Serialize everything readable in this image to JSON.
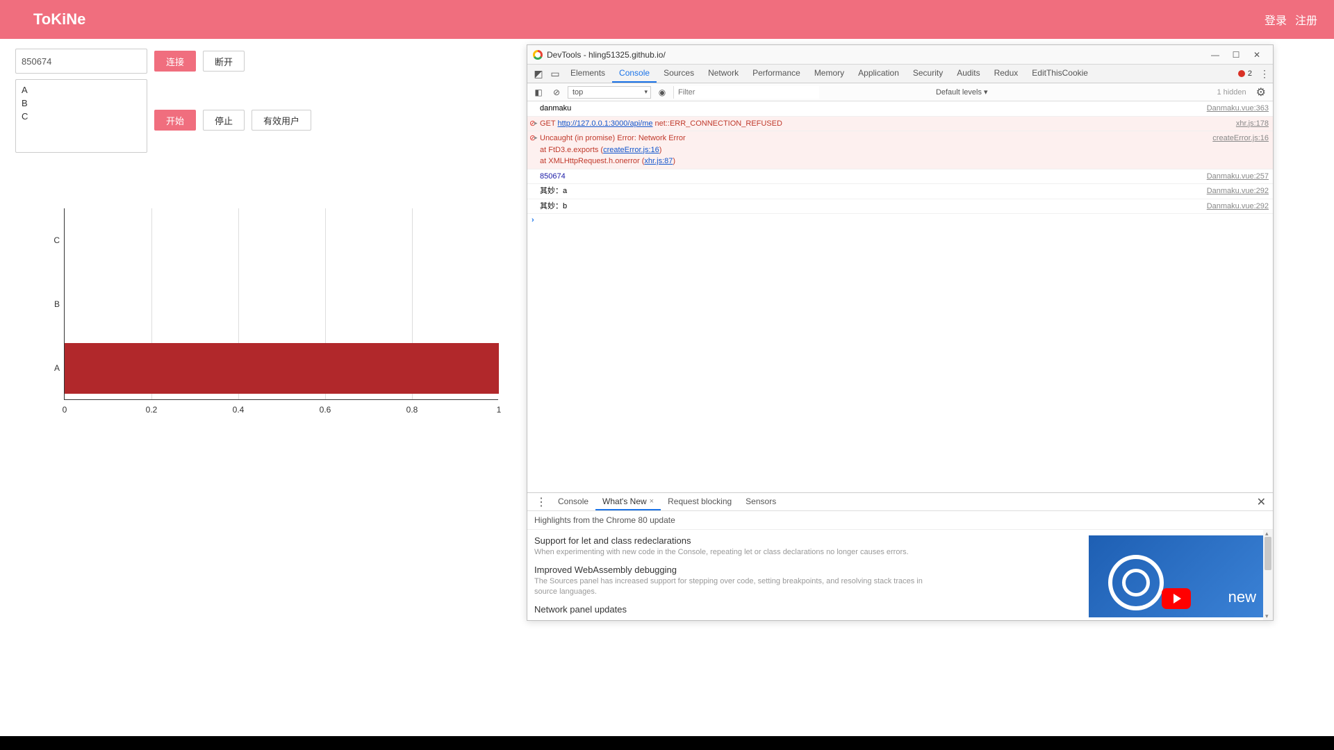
{
  "topbar": {
    "brand": "ToKiNe",
    "login": "登录",
    "register": "注册"
  },
  "controls": {
    "input_value": "850674",
    "connect": "连接",
    "disconnect": "断开",
    "log_text": "A\nB\nC",
    "start": "开始",
    "stop": "停止",
    "valid_users": "有效用户"
  },
  "chart_data": {
    "type": "bar",
    "orientation": "horizontal",
    "categories": [
      "A",
      "B",
      "C"
    ],
    "values": [
      1.0,
      0,
      0
    ],
    "xlabel": "",
    "ylabel": "",
    "xlim": [
      0,
      1
    ],
    "xticks": [
      0,
      0.2,
      0.4,
      0.6,
      0.8,
      1
    ],
    "bar_color": "#b1282b"
  },
  "devtools": {
    "title": "DevTools - hling51325.github.io/",
    "tabs": [
      "Elements",
      "Console",
      "Sources",
      "Network",
      "Performance",
      "Memory",
      "Application",
      "Security",
      "Audits",
      "Redux",
      "EditThisCookie"
    ],
    "active_tab": "Console",
    "error_count": "2",
    "toolbar": {
      "context": "top",
      "filter_placeholder": "Filter",
      "levels": "Default levels ▾",
      "hidden": "1 hidden"
    },
    "logs": [
      {
        "type": "log",
        "msg": "danmaku",
        "src": "Danmaku.vue:363"
      },
      {
        "type": "error",
        "expandable": true,
        "pre": "GET ",
        "link": "http://127.0.0.1:3000/api/me",
        "post": " net::ERR_CONNECTION_REFUSED",
        "src": "xhr.js:178"
      },
      {
        "type": "error",
        "expandable": true,
        "msg": "Uncaught (in promise) Error: Network Error",
        "stack": [
          {
            "pre": "    at FtD3.e.exports (",
            "link": "createError.js:16",
            "post": ")"
          },
          {
            "pre": "    at XMLHttpRequest.h.onerror (",
            "link": "xhr.js:87",
            "post": ")"
          }
        ],
        "src": "createError.js:16"
      },
      {
        "type": "info",
        "msg": "850674",
        "src": "Danmaku.vue:257"
      },
      {
        "type": "log",
        "msg": "其妙：a",
        "src": "Danmaku.vue:292"
      },
      {
        "type": "log",
        "msg": "其妙：b",
        "src": "Danmaku.vue:292"
      }
    ],
    "drawer": {
      "tabs": [
        "Console",
        "What's New",
        "Request blocking",
        "Sensors"
      ],
      "active": "What's New",
      "subtitle": "Highlights from the Chrome 80 update",
      "features": [
        {
          "title": "Support for let and class redeclarations",
          "desc": "When experimenting with new code in the Console, repeating let or class declarations no longer causes errors."
        },
        {
          "title": "Improved WebAssembly debugging",
          "desc": "The Sources panel has increased support for stepping over code, setting breakpoints, and resolving stack traces in source languages."
        },
        {
          "title": "Network panel updates",
          "desc": ""
        }
      ],
      "video_label": "new"
    }
  }
}
